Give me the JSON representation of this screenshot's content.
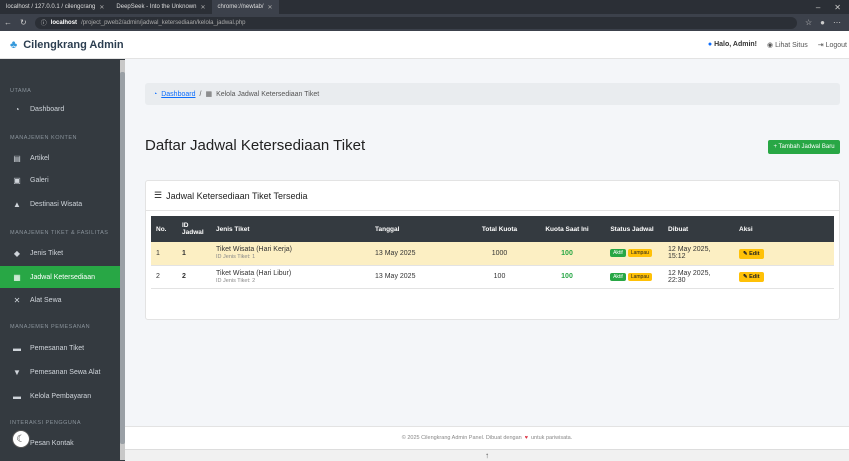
{
  "browser": {
    "tabs": [
      "localhost / 127.0.0.1 / cilengcrang",
      "DeepSeek - Into the Unknown",
      "chrome://newtab/"
    ],
    "url_host": "localhost",
    "url_path": "/project_pweb2/admin/jadwal_ketersediaan/kelola_jadwal.php"
  },
  "topnav": {
    "brand": "Cilengkrang Admin",
    "user": "Halo, Admin!",
    "view_site": "Lihat Situs",
    "logout": "Logout"
  },
  "sidebar": {
    "h1": "UTAMA",
    "dashboard": "Dashboard",
    "h2": "MANAJEMEN KONTEN",
    "artikel": "Artikel",
    "galeri": "Galeri",
    "destinasi": "Destinasi Wisata",
    "h3": "MANAJEMEN TIKET & FASILITAS",
    "jenis": "Jenis Tiket",
    "jadwal": "Jadwal Ketersediaan",
    "alat": "Alat Sewa",
    "h4": "MANAJEMEN PEMESANAN",
    "pemesanan_tiket": "Pemesanan Tiket",
    "pemesanan_sewa": "Pemesanan Sewa Alat",
    "pembayaran": "Kelola Pembayaran",
    "h5": "INTERAKSI PENGGUNA",
    "pesan": "Pesan Kontak"
  },
  "breadcrumb": {
    "home": "Dashboard",
    "sep": "/",
    "current": "Kelola Jadwal Ketersediaan Tiket"
  },
  "page": {
    "title": "Daftar Jadwal Ketersediaan Tiket",
    "add_button": "+ Tambah Jadwal Baru",
    "card_title": "Jadwal Ketersediaan Tiket Tersedia"
  },
  "table": {
    "headers": [
      "No.",
      "ID Jadwal",
      "Jenis Tiket",
      "Tanggal",
      "Total Kuota",
      "Kuota Saat Ini",
      "Status Jadwal",
      "Dibuat",
      "Aksi"
    ],
    "rows": [
      {
        "no": "1",
        "id": "1",
        "jenis": "Tiket Wisata (Hari Kerja)",
        "jenis_sub": "ID Jenis Tiket: 1",
        "tanggal": "13 May 2025",
        "total": "1000",
        "saat": "100",
        "s1": "Aktif",
        "s2": "Lampau",
        "dibuat": "12 May 2025, 15:12",
        "aksi": "Edit"
      },
      {
        "no": "2",
        "id": "2",
        "jenis": "Tiket Wisata (Hari Libur)",
        "jenis_sub": "ID Jenis Tiket: 2",
        "tanggal": "13 May 2025",
        "total": "100",
        "saat": "100",
        "s1": "Aktif",
        "s2": "Lampau",
        "dibuat": "12 May 2025, 22:30",
        "aksi": "Edit"
      }
    ]
  },
  "footer": {
    "pre": "© 2025 Cilengkrang Admin Panel. Dibuat dengan",
    "post": "untuk pariwisata."
  }
}
